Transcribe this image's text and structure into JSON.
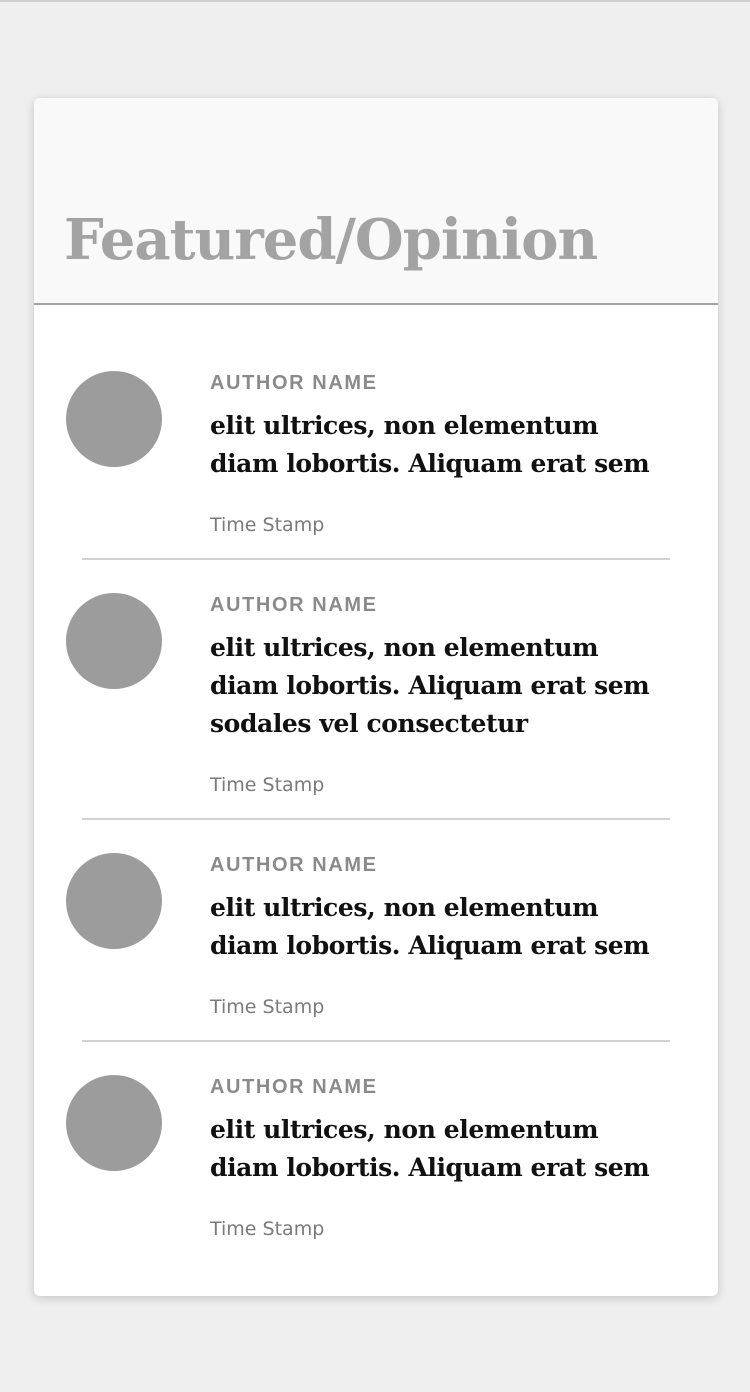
{
  "section": {
    "title": "Featured/Opinion"
  },
  "items": [
    {
      "author": "AUTHOR NAME",
      "headline_lines": [
        "elit ultrices, non elementum",
        "diam lobortis. Aliquam erat sem"
      ],
      "timestamp": "Time Stamp"
    },
    {
      "author": "AUTHOR NAME",
      "headline_lines": [
        "elit ultrices, non elementum",
        "diam lobortis. Aliquam erat sem",
        "sodales vel consectetur"
      ],
      "timestamp": "Time Stamp"
    },
    {
      "author": "AUTHOR NAME",
      "headline_lines": [
        "elit ultrices, non elementum",
        "diam lobortis. Aliquam erat sem"
      ],
      "timestamp": "Time Stamp"
    },
    {
      "author": "AUTHOR NAME",
      "headline_lines": [
        "elit ultrices, non elementum",
        "diam lobortis. Aliquam erat sem"
      ],
      "timestamp": "Time Stamp"
    }
  ],
  "colors": {
    "page_background": "#efefef",
    "card_background": "#ffffff",
    "header_background": "#f9f9f9",
    "title_color": "#a3a3a3",
    "avatar_color": "#9c9c9c",
    "author_color": "#8a8a8a",
    "headline_color": "#111111",
    "timestamp_color": "#7a7a7a"
  }
}
